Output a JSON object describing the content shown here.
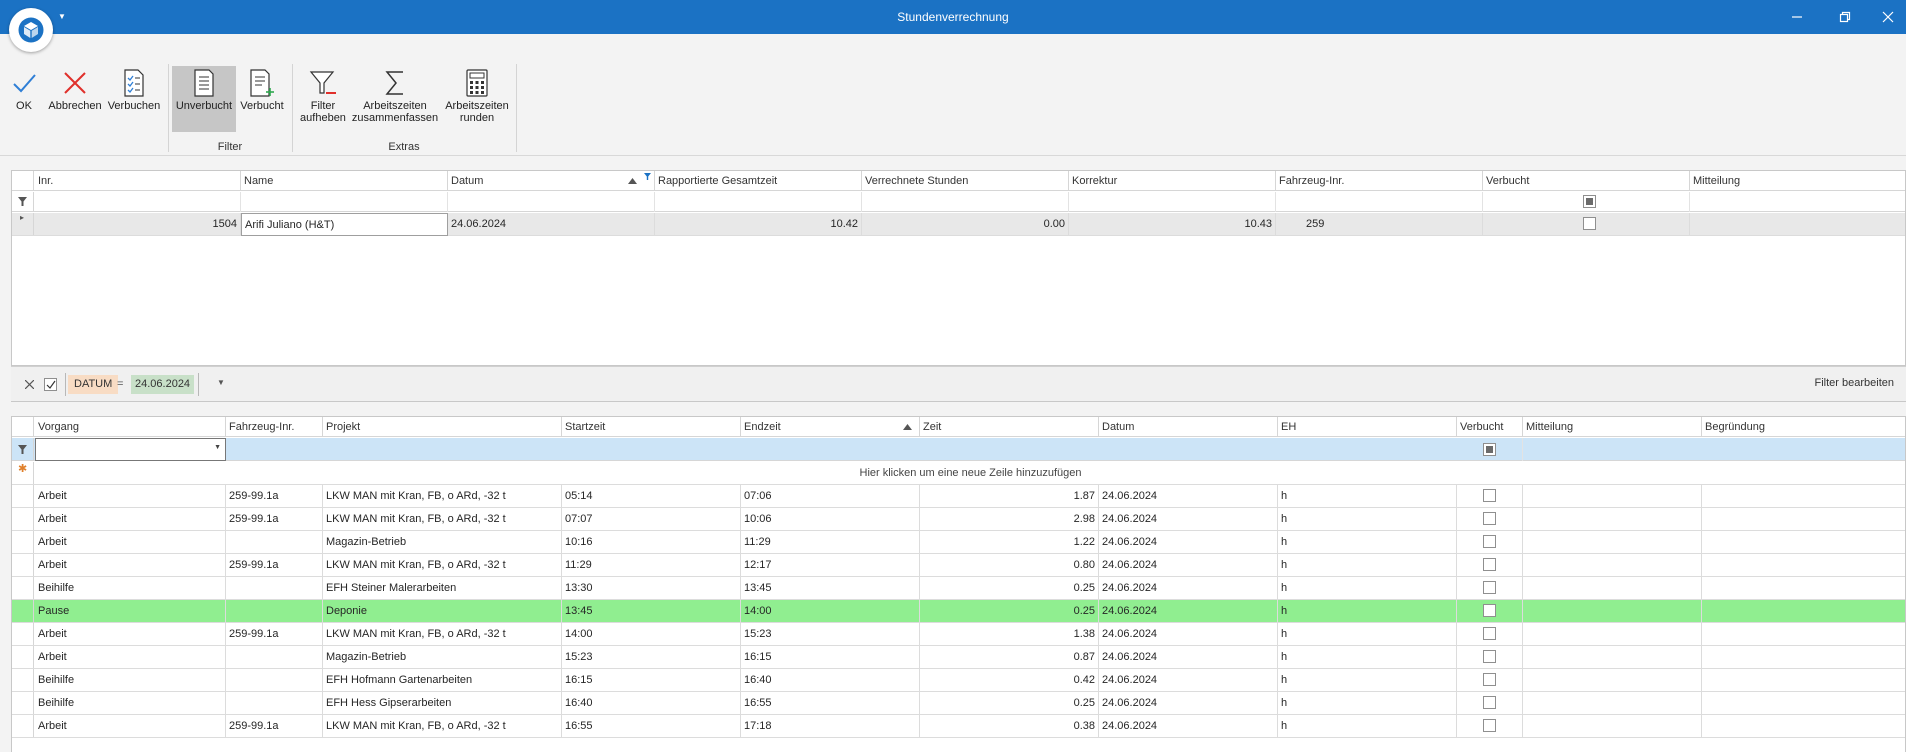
{
  "window": {
    "title": "Stundenverrechnung",
    "logo_icon": "package-cube-icon",
    "accent_color": "#1b72c4"
  },
  "ribbon": {
    "buttons": {
      "ok": "OK",
      "abbrechen": "Abbrechen",
      "verbuchen": "Verbuchen",
      "unverbucht": "Unverbucht",
      "verbucht": "Verbucht",
      "filter_aufheben_1": "Filter",
      "filter_aufheben_2": "aufheben",
      "zusammenfassen_1": "Arbeitszeiten",
      "zusammenfassen_2": "zusammenfassen",
      "runden_1": "Arbeitszeiten",
      "runden_2": "runden"
    },
    "groups": {
      "filter": "Filter",
      "extras": "Extras"
    }
  },
  "top_grid": {
    "headers": [
      "Inr.",
      "Name",
      "Datum",
      "Rapportierte Gesamtzeit",
      "Verrechnete Stunden",
      "Korrektur",
      "Fahrzeug-Inr.",
      "Verbucht",
      "Mitteilung"
    ],
    "rows": [
      {
        "inr": "1504",
        "name": "Arifi Juliano (H&T)",
        "datum": "24.06.2024",
        "gesamtzeit": "10.42",
        "verrechnet": "0.00",
        "korrektur": "10.43",
        "fahrzeug": "259",
        "verbucht": false,
        "mitteilung": ""
      }
    ]
  },
  "filter_panel": {
    "field": "DATUM",
    "operator": "=",
    "value": "24.06.2024",
    "edit_label": "Filter bearbeiten"
  },
  "bottom_grid": {
    "headers": [
      "Vorgang",
      "Fahrzeug-Inr.",
      "Projekt",
      "Startzeit",
      "Endzeit",
      "Zeit",
      "Datum",
      "EH",
      "Verbucht",
      "Mitteilung",
      "Begründung"
    ],
    "new_row_hint": "Hier klicken um eine neue Zeile hinzuzufügen",
    "highlight_color": "#90ee90",
    "rows": [
      {
        "vorgang": "Arbeit",
        "fahrzeug": "259-99.1a",
        "projekt": "LKW MAN mit Kran, FB, o ARd, -32 t",
        "start": "05:14",
        "end": "07:06",
        "zeit": "1.87",
        "datum": "24.06.2024",
        "eh": "h",
        "highlight": false
      },
      {
        "vorgang": "Arbeit",
        "fahrzeug": "259-99.1a",
        "projekt": "LKW MAN mit Kran, FB, o ARd, -32 t",
        "start": "07:07",
        "end": "10:06",
        "zeit": "2.98",
        "datum": "24.06.2024",
        "eh": "h",
        "highlight": false
      },
      {
        "vorgang": "Arbeit",
        "fahrzeug": "",
        "projekt": "Magazin-Betrieb",
        "start": "10:16",
        "end": "11:29",
        "zeit": "1.22",
        "datum": "24.06.2024",
        "eh": "h",
        "highlight": false
      },
      {
        "vorgang": "Arbeit",
        "fahrzeug": "259-99.1a",
        "projekt": "LKW MAN mit Kran, FB, o ARd, -32 t",
        "start": "11:29",
        "end": "12:17",
        "zeit": "0.80",
        "datum": "24.06.2024",
        "eh": "h",
        "highlight": false
      },
      {
        "vorgang": "Beihilfe",
        "fahrzeug": "",
        "projekt": "EFH Steiner Malerarbeiten",
        "start": "13:30",
        "end": "13:45",
        "zeit": "0.25",
        "datum": "24.06.2024",
        "eh": "h",
        "highlight": false
      },
      {
        "vorgang": "Pause",
        "fahrzeug": "",
        "projekt": "Deponie",
        "start": "13:45",
        "end": "14:00",
        "zeit": "0.25",
        "datum": "24.06.2024",
        "eh": "h",
        "highlight": true
      },
      {
        "vorgang": "Arbeit",
        "fahrzeug": "259-99.1a",
        "projekt": "LKW MAN mit Kran, FB, o ARd, -32 t",
        "start": "14:00",
        "end": "15:23",
        "zeit": "1.38",
        "datum": "24.06.2024",
        "eh": "h",
        "highlight": false
      },
      {
        "vorgang": "Arbeit",
        "fahrzeug": "",
        "projekt": "Magazin-Betrieb",
        "start": "15:23",
        "end": "16:15",
        "zeit": "0.87",
        "datum": "24.06.2024",
        "eh": "h",
        "highlight": false
      },
      {
        "vorgang": "Beihilfe",
        "fahrzeug": "",
        "projekt": "EFH Hofmann Gartenarbeiten",
        "start": "16:15",
        "end": "16:40",
        "zeit": "0.42",
        "datum": "24.06.2024",
        "eh": "h",
        "highlight": false
      },
      {
        "vorgang": "Beihilfe",
        "fahrzeug": "",
        "projekt": "EFH Hess Gipserarbeiten",
        "start": "16:40",
        "end": "16:55",
        "zeit": "0.25",
        "datum": "24.06.2024",
        "eh": "h",
        "highlight": false
      },
      {
        "vorgang": "Arbeit",
        "fahrzeug": "259-99.1a",
        "projekt": "LKW MAN mit Kran, FB, o ARd, -32 t",
        "start": "16:55",
        "end": "17:18",
        "zeit": "0.38",
        "datum": "24.06.2024",
        "eh": "h",
        "highlight": false
      }
    ]
  }
}
